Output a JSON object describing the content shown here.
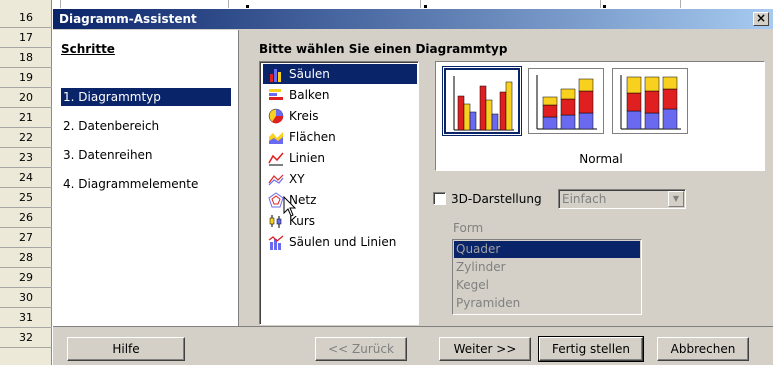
{
  "sheet": {
    "row_numbers": [
      "16",
      "17",
      "18",
      "19",
      "20",
      "21",
      "22",
      "23",
      "24",
      "25",
      "26",
      "27",
      "28",
      "29",
      "30",
      "31",
      "32"
    ]
  },
  "dialog": {
    "title": "Diagramm-Assistent",
    "close_label": "×",
    "steps_heading": "Schritte",
    "steps": [
      {
        "label": "1. Diagrammtyp",
        "active": true
      },
      {
        "label": "2. Datenbereich",
        "active": false
      },
      {
        "label": "3. Datenreihen",
        "active": false
      },
      {
        "label": "4. Diagrammelemente",
        "active": false
      }
    ],
    "type_heading": "Bitte wählen Sie einen Diagrammtyp",
    "chart_types": [
      {
        "label": "Säulen",
        "icon": "column-chart-icon",
        "selected": true
      },
      {
        "label": "Balken",
        "icon": "bar-chart-icon",
        "selected": false
      },
      {
        "label": "Kreis",
        "icon": "pie-chart-icon",
        "selected": false
      },
      {
        "label": "Flächen",
        "icon": "area-chart-icon",
        "selected": false
      },
      {
        "label": "Linien",
        "icon": "line-chart-icon",
        "selected": false
      },
      {
        "label": "XY",
        "icon": "xy-chart-icon",
        "selected": false
      },
      {
        "label": "Netz",
        "icon": "net-chart-icon",
        "selected": false
      },
      {
        "label": "Kurs",
        "icon": "stock-chart-icon",
        "selected": false
      },
      {
        "label": "Säulen und Linien",
        "icon": "column-line-chart-icon",
        "selected": false
      }
    ],
    "variant_label": "Normal",
    "three_d_label": "3D-Darstellung",
    "three_d_checked": false,
    "depth_select_value": "Einfach",
    "form_label": "Form",
    "form_options": [
      {
        "label": "Quader",
        "selected": true
      },
      {
        "label": "Zylinder",
        "selected": false
      },
      {
        "label": "Kegel",
        "selected": false
      },
      {
        "label": "Pyramiden",
        "selected": false
      }
    ],
    "buttons": {
      "help": "Hilfe",
      "back": "<< Zurück",
      "next": "Weiter >>",
      "finish": "Fertig stellen",
      "cancel": "Abbrechen"
    }
  },
  "colors": {
    "selection": "#0a246a",
    "dialog_face": "#d4d0c8",
    "series_red": "#e02020",
    "series_yellow": "#f8d020",
    "series_blue": "#6a6af0"
  }
}
